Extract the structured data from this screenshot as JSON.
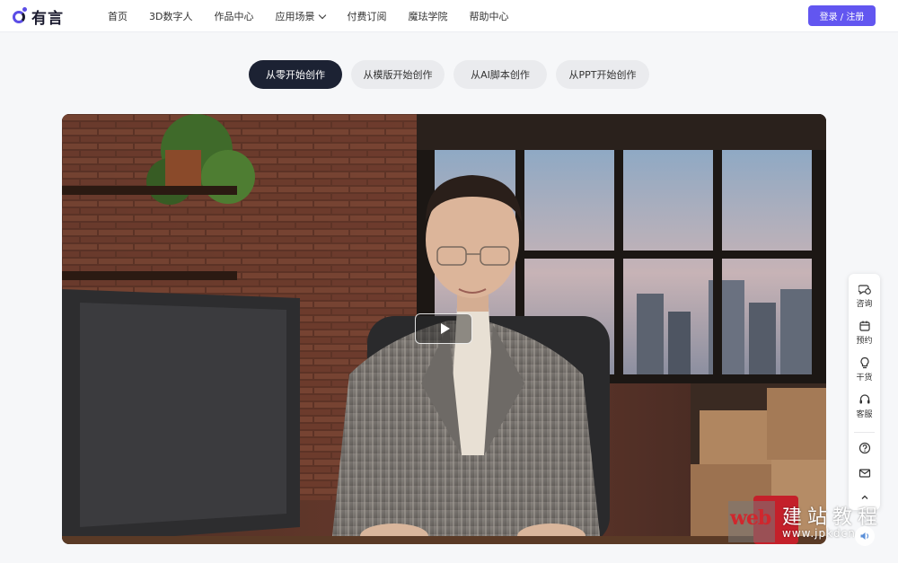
{
  "brand": {
    "name": "有言",
    "accent": "#6256f0"
  },
  "nav": {
    "items": [
      {
        "label": "首页"
      },
      {
        "label": "3D数字人"
      },
      {
        "label": "作品中心"
      },
      {
        "label": "应用场景",
        "has_dropdown": true
      },
      {
        "label": "付费订阅"
      },
      {
        "label": "魔珐学院"
      },
      {
        "label": "帮助中心"
      }
    ]
  },
  "header": {
    "login_label": "登录 / 注册"
  },
  "tabs": [
    {
      "label": "从零开始创作",
      "active": true
    },
    {
      "label": "从模版开始创作",
      "active": false
    },
    {
      "label": "从AI脚本创作",
      "active": false
    },
    {
      "label": "从PPT开始创作",
      "active": false
    }
  ],
  "video": {
    "play_icon": "play-icon"
  },
  "float_bar": {
    "items": [
      {
        "label": "咨询",
        "icon": "chat-icon"
      },
      {
        "label": "预约",
        "icon": "calendar-icon"
      },
      {
        "label": "干货",
        "icon": "lightbulb-icon"
      },
      {
        "label": "客服",
        "icon": "headset-icon"
      }
    ],
    "extra_icons": [
      "help-icon",
      "mail-icon",
      "chevron-up-icon"
    ]
  },
  "watermark": {
    "brand": "web",
    "text": "建站教程",
    "url": "www.jpkdcn"
  }
}
